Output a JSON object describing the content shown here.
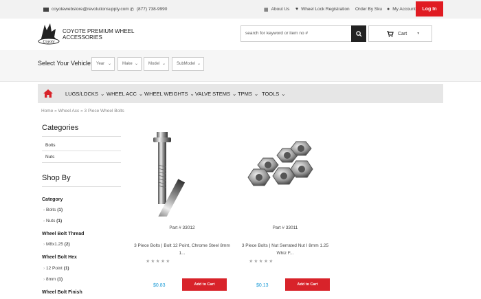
{
  "topbar": {
    "email": "coyotewebstore@revolutionsupply.com",
    "phone": "(877) 738-9990",
    "about": "About Us",
    "registration": "Wheel Lock Registration",
    "order_by_sku": "Order By Sku",
    "account": "My Account",
    "login": "Log In"
  },
  "header": {
    "brand": "COYOTE PREMIUM WHEEL ACCESSORIES",
    "search_placeholder": "search for keyword or item no #",
    "cart": "Cart"
  },
  "vehicle": {
    "label": "Select Your Vehicle:",
    "selects": [
      "Year",
      "Make",
      "Model",
      "SubModel"
    ]
  },
  "nav": [
    "LUGS/LOCKS",
    "WHEEL ACC",
    "WHEEL WEIGHTS",
    "VALVE STEMS",
    "TPMS",
    "TOOLS"
  ],
  "breadcrumb": [
    "Home",
    "Wheel Acc",
    "3 Piece Wheel Bolts"
  ],
  "sidebar": {
    "categories_title": "Categories",
    "categories": [
      "Bolts",
      "Nuts"
    ],
    "shop_by_title": "Shop By",
    "facets": [
      {
        "title": "Category",
        "options": [
          {
            "label": "Bolts",
            "count": "(1)"
          },
          {
            "label": "Nuts",
            "count": "(1)"
          }
        ]
      },
      {
        "title": "Wheel Bolt Thread",
        "options": [
          {
            "label": "M8x1.25",
            "count": "(2)"
          }
        ]
      },
      {
        "title": "Wheel Bolt Hex",
        "options": [
          {
            "label": "12 Point",
            "count": "(1)"
          },
          {
            "label": "8mm",
            "count": "(1)"
          }
        ]
      },
      {
        "title": "Wheel Bolt Finish",
        "options": []
      }
    ]
  },
  "products": [
    {
      "part": "Part # 33012",
      "name": "3 Piece Bolts | Bolt 12 Point, Chrome Steel 8mm 1...",
      "price": "$0.83",
      "button": "Add to Cart",
      "rating": 0
    },
    {
      "part": "Part # 33011",
      "name": "3 Piece Bolts | Nut Serrated Nut I 8mm 1.25 Whiz F...",
      "price": "$0.13",
      "button": "Add to Cart",
      "rating": 0
    }
  ],
  "colors": {
    "accent": "#e01b22",
    "price": "#1a9bd7",
    "nav_bg": "#e6e6e6"
  }
}
